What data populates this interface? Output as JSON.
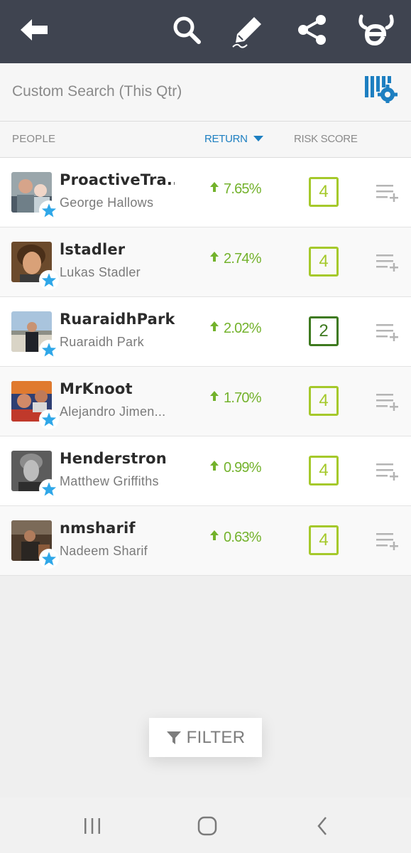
{
  "topbar": {
    "icons": [
      "back-arrow-icon",
      "search-icon",
      "edit-pencil-icon",
      "share-icon",
      "etoro-logo-icon"
    ],
    "background": "#3f4450"
  },
  "search": {
    "title": "Custom Search (This Qtr)"
  },
  "columns": {
    "people": "PEOPLE",
    "return": "RETURN",
    "risk": "RISK SCORE"
  },
  "people": [
    {
      "username": "ProactiveTra...",
      "fullname": "George Hallows",
      "return": "7.65%",
      "risk": "4"
    },
    {
      "username": "lstadler",
      "fullname": "Lukas Stadler",
      "return": "2.74%",
      "risk": "4"
    },
    {
      "username": "RuaraidhPark",
      "fullname": "Ruaraidh Park",
      "return": "2.02%",
      "risk": "2"
    },
    {
      "username": "MrKnoot",
      "fullname": "Alejandro Jimen...",
      "return": "1.70%",
      "risk": "4"
    },
    {
      "username": "Henderstron",
      "fullname": "Matthew Griffiths",
      "return": "0.99%",
      "risk": "4"
    },
    {
      "username": "nmsharif",
      "fullname": "Nadeem Sharif",
      "return": "0.63%",
      "risk": "4"
    }
  ],
  "filter": {
    "label": "FILTER"
  },
  "colors": {
    "accent": "#1d7fc1",
    "positive": "#73b22c",
    "risk_light": "#a5c92b",
    "risk_dark": "#3e7a1f",
    "star": "#2fa7e8"
  }
}
